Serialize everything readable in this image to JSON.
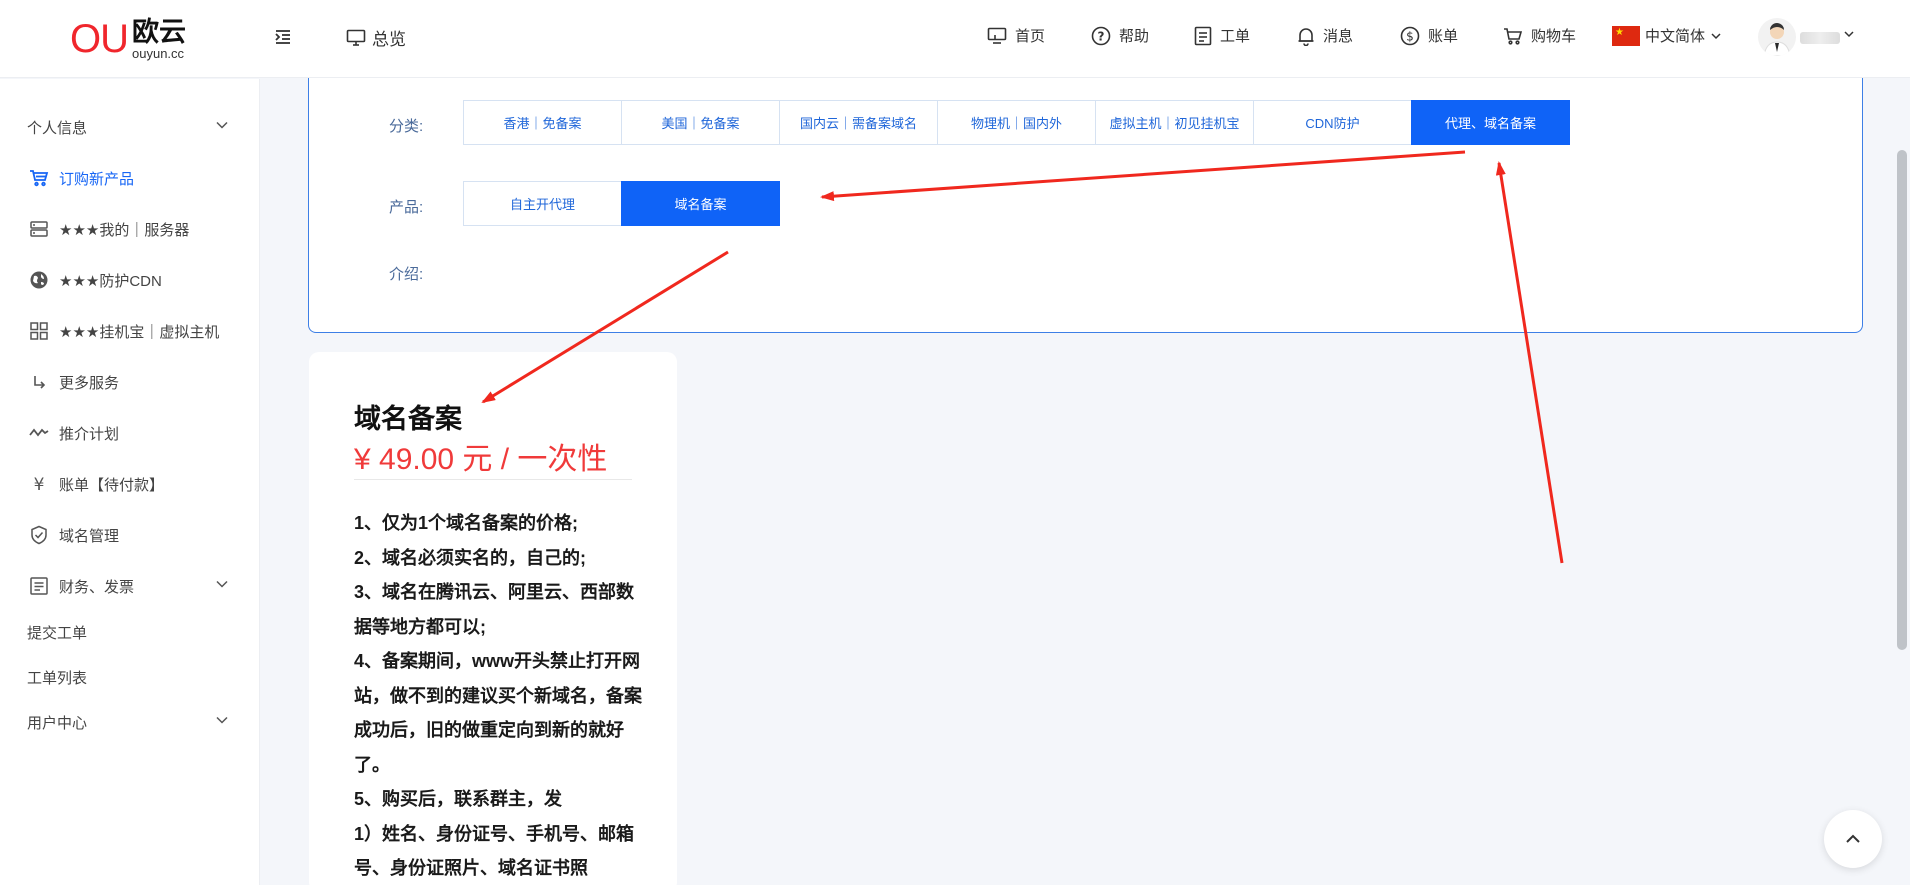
{
  "header": {
    "logo_ou": "OU",
    "logo_cn": "欧云",
    "logo_domain": "ouyun.cc",
    "overview_label": "总览",
    "nav": [
      {
        "label": "首页",
        "icon": "monitor-icon"
      },
      {
        "label": "帮助",
        "icon": "help-icon"
      },
      {
        "label": "工单",
        "icon": "ticket-icon"
      },
      {
        "label": "消息",
        "icon": "bell-icon"
      },
      {
        "label": "账单",
        "icon": "dollar-icon"
      },
      {
        "label": "购物车",
        "icon": "cart-icon"
      }
    ],
    "language": "中文简体"
  },
  "sidebar": {
    "items": [
      {
        "label": "个人信息",
        "icon": "",
        "chevron": true
      },
      {
        "label": "订购新产品",
        "icon": "cart-icon",
        "active": true
      },
      {
        "label": "★★★我的｜服务器",
        "icon": "server-icon"
      },
      {
        "label": "★★★防护CDN",
        "icon": "globe-icon"
      },
      {
        "label": "★★★挂机宝｜虚拟主机",
        "icon": "grid-icon"
      },
      {
        "label": "更多服务",
        "icon": "return-arrow-icon"
      },
      {
        "label": "推介计划",
        "icon": "wave-icon"
      },
      {
        "label": "账单【待付款】",
        "icon": "yen-icon"
      },
      {
        "label": "域名管理",
        "icon": "check-shield-icon"
      },
      {
        "label": "财务、发票",
        "icon": "document-icon",
        "chevron": true
      },
      {
        "label": "提交工单",
        "icon": ""
      },
      {
        "label": "工单列表",
        "icon": ""
      },
      {
        "label": "用户中心",
        "icon": "",
        "chevron": true
      }
    ]
  },
  "filter": {
    "category_label": "分类:",
    "product_label": "产品:",
    "intro_label": "介绍:",
    "categories": [
      "香港｜免备案",
      "美国｜免备案",
      "国内云｜需备案域名",
      "物理机｜国内外",
      "虚拟主机｜初见挂机宝",
      "CDN防护",
      "代理、域名备案"
    ],
    "selected_category": 6,
    "products": [
      "自主开代理",
      "域名备案"
    ],
    "selected_product": 1
  },
  "product": {
    "title": "域名备案",
    "price": "¥ 49.00 元 / 一次性",
    "description": [
      "1、仅为1个域名备案的价格;",
      "2、域名必须实名的，自己的;",
      "3、域名在腾讯云、阿里云、西部数据等地方都可以;",
      "4、备案期间，www开头禁止打开网站，做不到的建议买个新域名，备案成功后，旧的做重定向到新的就好了。",
      "5、购买后，联系群主，发",
      "1）姓名、身份证号、手机号、邮箱号、身份证照片、域名证书照"
    ]
  },
  "colors": {
    "accent": "#0f63f7",
    "price": "#f03a3a",
    "logo_red": "#f0262c",
    "arrow": "#f0281e"
  }
}
